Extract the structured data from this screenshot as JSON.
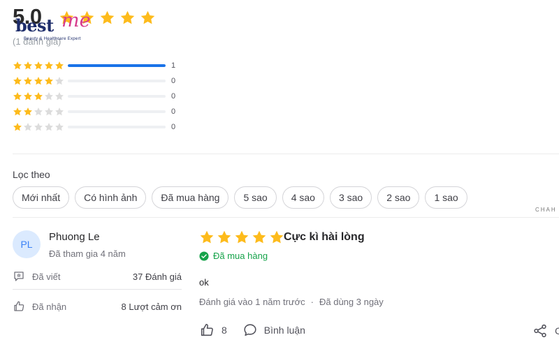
{
  "summary": {
    "score": "5.0",
    "score_stars": 5,
    "total_label": "(1 đánh giá)",
    "distribution": [
      {
        "stars": 5,
        "count": "1",
        "fraction": 1.0
      },
      {
        "stars": 4,
        "count": "0",
        "fraction": 0
      },
      {
        "stars": 3,
        "count": "0",
        "fraction": 0
      },
      {
        "stars": 2,
        "count": "0",
        "fraction": 0
      },
      {
        "stars": 1,
        "count": "0",
        "fraction": 0
      }
    ]
  },
  "logo": {
    "text": "best",
    "accent": "me",
    "tagline": "Beauty & Healthcare Expert"
  },
  "filter": {
    "label": "Lọc theo",
    "chips": [
      "Mới nhất",
      "Có hình ảnh",
      "Đã mua hàng",
      "5 sao",
      "4 sao",
      "3 sao",
      "2 sao",
      "1 sao"
    ]
  },
  "watermark": "CHAH",
  "reviewer": {
    "initials": "PL",
    "name": "Phuong Le",
    "joined": "Đã tham gia 4 năm",
    "stats": [
      {
        "label": "Đã viết",
        "value": "37 Đánh giá",
        "icon": "review-written-icon"
      },
      {
        "label": "Đã nhận",
        "value": "8 Lượt cảm ơn",
        "icon": "thumbs-up-icon"
      }
    ]
  },
  "review": {
    "rating": 5,
    "title": "Cực kì hài lòng",
    "verified": "Đã mua hàng",
    "body": "ok",
    "posted": "Đánh giá vào 1 năm trước",
    "used": "Đã dùng 3 ngày",
    "likes": "8",
    "comment_label": "Bình luận",
    "share_label": "C"
  },
  "colors": {
    "star": "#fdbb1c",
    "star_empty": "#dcdcdc",
    "bar_fill": "#1a73e8",
    "verified": "#16a34a",
    "avatar_bg": "#dbeafe",
    "avatar_text": "#3b82f6"
  }
}
